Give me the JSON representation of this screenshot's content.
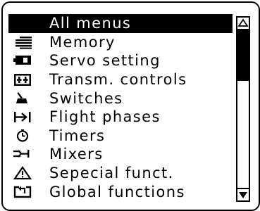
{
  "menu": {
    "items": [
      {
        "label": "All menus",
        "icon": "none",
        "selected": true
      },
      {
        "label": "Memory",
        "icon": "memory-icon"
      },
      {
        "label": "Servo setting",
        "icon": "servo-icon"
      },
      {
        "label": "Transm. controls",
        "icon": "transmitter-controls-icon"
      },
      {
        "label": "Switches",
        "icon": "switch-icon"
      },
      {
        "label": "Flight phases",
        "icon": "flight-phases-icon"
      },
      {
        "label": "Timers",
        "icon": "timer-icon"
      },
      {
        "label": "Mixers",
        "icon": "mixer-icon"
      },
      {
        "label": "Sepecial funct.",
        "icon": "warning-triangle-icon"
      },
      {
        "label": "Global functions",
        "icon": "global-functions-icon"
      }
    ]
  },
  "scrollbar": {
    "visible_fraction": 0.32,
    "position_fraction": 0.0
  },
  "colors": {
    "foreground": "#000000",
    "background": "#ffffff"
  }
}
